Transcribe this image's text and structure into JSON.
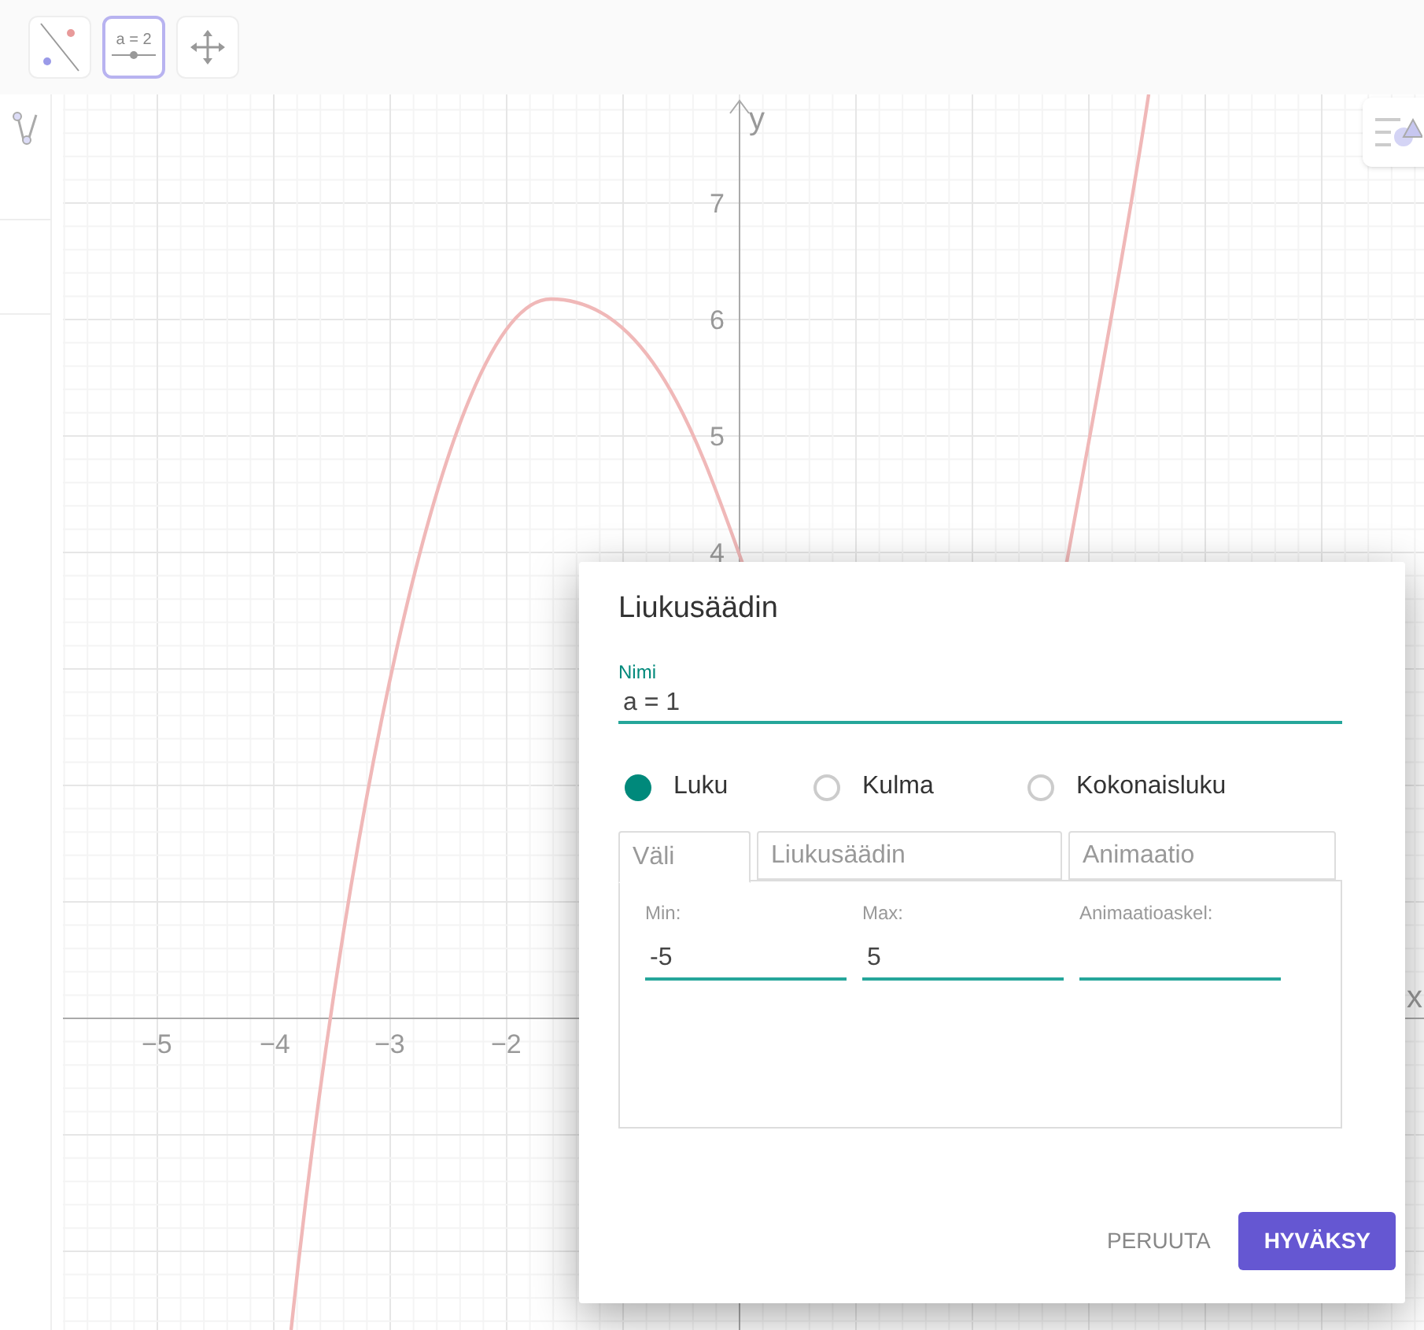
{
  "toolbar": {
    "tools": [
      {
        "kind": "line",
        "selected": false
      },
      {
        "kind": "slider",
        "label": "a = 2",
        "selected": true
      },
      {
        "kind": "move",
        "selected": false
      }
    ]
  },
  "graph": {
    "x_axis_label": "x",
    "y_axis_label": "y",
    "x_tick_labels": [
      "−5",
      "−4",
      "−3",
      "−2"
    ],
    "y_tick_labels": [
      "7",
      "6",
      "5",
      "4"
    ]
  },
  "dialog": {
    "title": "Liukusäädin",
    "name_field": {
      "label": "Nimi",
      "value": "a = 1"
    },
    "number_types": [
      {
        "label": "Luku",
        "selected": true
      },
      {
        "label": "Kulma",
        "selected": false
      },
      {
        "label": "Kokonaisluku",
        "selected": false
      }
    ],
    "tabs": [
      {
        "label": "Väli",
        "selected": true
      },
      {
        "label": "Liukusäädin",
        "selected": false
      },
      {
        "label": "Animaatio",
        "selected": false
      }
    ],
    "fields": [
      {
        "label": "Min:",
        "value": "-5"
      },
      {
        "label": "Max:",
        "value": "5"
      },
      {
        "label": "Animaatioaskel:"
      }
    ],
    "buttons": [
      {
        "label": "PERUUTA",
        "kind": "text"
      },
      {
        "label": "HYVÄKSY",
        "kind": "primary"
      }
    ]
  }
}
